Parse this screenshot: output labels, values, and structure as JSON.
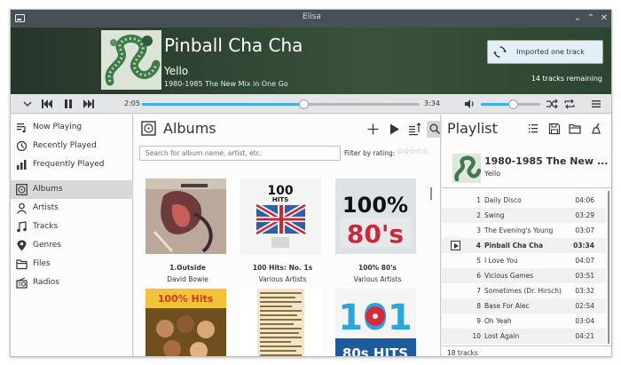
{
  "window": {
    "title": "Elisa"
  },
  "header": {
    "song_title": "Pinball Cha Cha",
    "artist": "Yello",
    "album": "1980-1985 The New Mix in One Go",
    "notification": "Imported one track",
    "tracks_remaining": "14 tracks remaining"
  },
  "controls": {
    "current_time": "2:05",
    "total_time": "3:34",
    "seek_fraction": 0.584,
    "volume_fraction": 0.55
  },
  "nav": {
    "items": [
      {
        "label": "Now Playing",
        "icon": "now-playing-icon"
      },
      {
        "label": "Recently Played",
        "icon": "recently-played-icon"
      },
      {
        "label": "Frequently Played",
        "icon": "frequently-played-icon"
      },
      {
        "label": "Albums",
        "icon": "albums-icon",
        "selected": true
      },
      {
        "label": "Artists",
        "icon": "artists-icon"
      },
      {
        "label": "Tracks",
        "icon": "tracks-icon"
      },
      {
        "label": "Genres",
        "icon": "genres-icon"
      },
      {
        "label": "Files",
        "icon": "files-icon"
      },
      {
        "label": "Radios",
        "icon": "radios-icon"
      }
    ]
  },
  "albums": {
    "title": "Albums",
    "search_placeholder": "Search for album name, artist, etc.",
    "filter_label": "Filter by rating:",
    "items": [
      {
        "name": "1.Outside",
        "artist": "David Bowie"
      },
      {
        "name": "100 Hits: No. 1s",
        "artist": "Various Artists"
      },
      {
        "name": "100% 80's",
        "artist": "Various Artists"
      },
      {
        "name": "",
        "artist": ""
      },
      {
        "name": "",
        "artist": ""
      },
      {
        "name": "",
        "artist": ""
      }
    ],
    "art_text": {
      "hits_a": "100",
      "hits_b": "HITS",
      "eighties_a": "100%",
      "eighties_b": "80's",
      "hot_a": "100% Hits",
      "onezeroone_a": "101",
      "onezeroone_b": "80s HITS"
    }
  },
  "playlist": {
    "title": "Playlist",
    "album": "1980-1985 The New ...",
    "artist": "Yello",
    "tracks": [
      {
        "num": "1",
        "title": "Daily Disco",
        "duration": "04:06"
      },
      {
        "num": "2",
        "title": "Swing",
        "duration": "03:29"
      },
      {
        "num": "3",
        "title": "The Evening's Young",
        "duration": "03:07"
      },
      {
        "num": "4",
        "title": "Pinball Cha Cha",
        "duration": "03:34",
        "current": true
      },
      {
        "num": "5",
        "title": "I Love You",
        "duration": "04:07"
      },
      {
        "num": "6",
        "title": "Vicious Games",
        "duration": "03:51"
      },
      {
        "num": "7",
        "title": "Sometimes (Dr. Hirsch)",
        "duration": "03:32"
      },
      {
        "num": "8",
        "title": "Base For Alec",
        "duration": "02:54"
      },
      {
        "num": "9",
        "title": "Oh Yeah",
        "duration": "03:04"
      },
      {
        "num": "10",
        "title": "Lost Again",
        "duration": "04:21"
      }
    ],
    "count": "18 tracks"
  },
  "colors": {
    "accent": "#3daee9",
    "titlebar": "#475057",
    "selection": "#d6d8da"
  }
}
